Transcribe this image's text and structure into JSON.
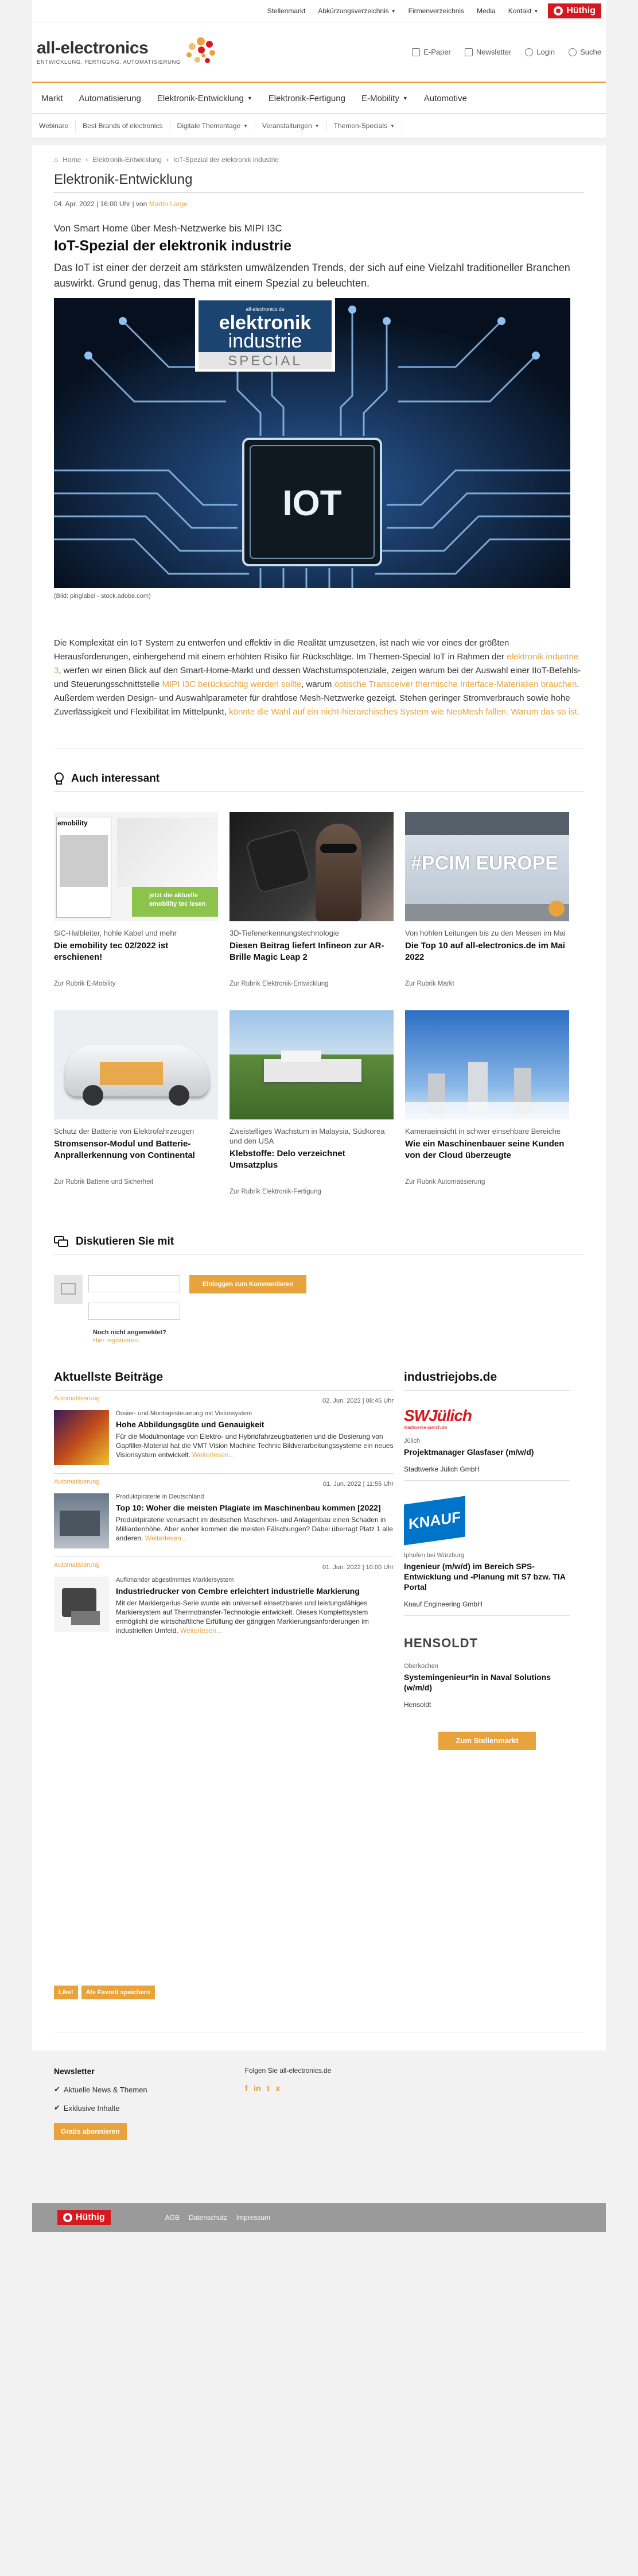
{
  "topbar": {
    "links": [
      "Stellenmarkt",
      "Abkürzungsverzeichnis",
      "Firmenverzeichnis",
      "Media",
      "Kontakt"
    ],
    "brand": "Hüthig"
  },
  "header": {
    "logo_name": "all-electronics",
    "logo_tag": "ENTWICKLUNG. FERTIGUNG. AUTOMATISIERUNG",
    "actions": [
      "E-Paper",
      "Newsletter",
      "Login",
      "Suche"
    ]
  },
  "mainnav": [
    "Markt",
    "Automatisierung",
    "Elektronik-Entwicklung",
    "Elektronik-Fertigung",
    "E-Mobility",
    "Automotive"
  ],
  "subnav": [
    "Webinare",
    "Best Brands of electronics",
    "Digitale Thementage",
    "Veranstaltungen",
    "Themen-Specials"
  ],
  "breadcrumb": {
    "home": "Home",
    "level1": "Elektronik-Entwicklung",
    "current": "IoT-Spezial der elektronik industrie"
  },
  "article": {
    "category": "Elektronik-Entwicklung",
    "meta_date": "04. Apr. 2022 | 16:00 Uhr | von",
    "meta_author": "Martin Large",
    "kicker": "Von Smart Home über Mesh-Netzwerke bis MIPI I3C",
    "title": "IoT-Spezial der elektronik industrie",
    "teaser": "Das IoT ist einer der derzeit am stärksten umwälzenden Trends, der sich auf eine Vielzahl traditioneller Branchen auswirkt. Grund genug, das Thema mit einem Spezial zu beleuchten.",
    "hero_brand_top": "all-electronics.de",
    "hero_brand_1": "elektronik",
    "hero_brand_2": "industrie",
    "hero_brand_3": "SPECIAL",
    "hero_chip": "IOT",
    "caption": "(Bild: pinglabel - stock.adobe.com)",
    "body_1": "Die Komplexität ein IoT System zu entwerfen und effektiv in die Realität umzusetzen, ist nach wie vor eines der größten Herausforderungen, einhergehend mit einem erhöhten Risiko für Rückschläge. Im Themen-Special IoT in Rahmen der ",
    "body_link1": "elektronik industrie 3",
    "body_2": ", werfen wir einen Blick auf den Smart-Home-Markt und dessen Wachstumspotenziale, zeigen warum bei der Auswahl einer IIoT-Befehls- und Steuerungsschnittstelle ",
    "body_link2": "MIPI I3C berücksichtig werden sollte",
    "body_3": ", warum ",
    "body_link3": "optische Transceiver thermische Interface-Materialien brauchen",
    "body_4": ". Außerdem werden Design- und Auswahlparameter für drahtlose Mesh-Netzwerke gezeigt. Stehen geringer Stromverbrauch sowie hohe Zuverlässigkeit und Flexibilität im Mittelpunkt, ",
    "body_link4": "könnte die Wahl auf ein nicht-hierarchisches System wie NeoMesh fallen. Warum das so ist."
  },
  "interesting": {
    "heading": "Auch interessant",
    "cards": [
      {
        "kicker": "SiC-Halbleiter, hohle Kabel und mehr",
        "title": "Die emobility tec 02/2022 ist erschienen!",
        "rubric": "Zur Rubrik E-Mobility",
        "thumb_label1": "emobility",
        "thumb_label2": "jetzt die aktuelle emobility tec lesen"
      },
      {
        "kicker": "3D-Tiefenerkennungstechnologie",
        "title": "Diesen Beitrag liefert Infineon zur AR-Brille Magic Leap 2",
        "rubric": "Zur Rubrik Elektronik-Entwicklung"
      },
      {
        "kicker": "Von hohlen Leitungen bis zu den Messen im Mai",
        "title": "Die Top 10 auf all-electronics.de im Mai 2022",
        "rubric": "Zur Rubrik Markt",
        "thumb_label1": "#PCIM EUROPE"
      },
      {
        "kicker": "Schutz der Batterie von Elektrofahrzeugen",
        "title": "Stromsensor-Modul und Batterie-Anprallerkennung von Continental",
        "rubric": "Zur Rubrik Batterie und Sicherheit"
      },
      {
        "kicker": "Zweistelliges Wachstum in Malaysia, Südkorea und den USA",
        "title": "Klebstoffe: Delo verzeichnet Umsatzplus",
        "rubric": "Zur Rubrik Elektronik-Fertigung"
      },
      {
        "kicker": "Kameraeinsicht in schwer einsehbare Bereiche",
        "title": "Wie ein Maschinenbauer seine Kunden von der Cloud überzeugte",
        "rubric": "Zur Rubrik Automatisierung"
      }
    ]
  },
  "discuss": {
    "heading": "Diskutieren Sie mit",
    "button": "Einloggen zum Kommentieren",
    "not_registered": "Noch nicht angemeldet?",
    "register": "Hier registrieren."
  },
  "latest": {
    "heading": "Aktuellste Beiträge",
    "posts": [
      {
        "category": "Automatisierung",
        "date": "02. Jun. 2022 | 08:45 Uhr",
        "kicker": "Dosier- und Montagesteuerung mit Visionsystem",
        "title": "Hohe Abbildungsgüte und Genauigkeit",
        "desc": "Für die Modulmontage von Elektro- und Hybridfahrzeugbatterien und die Dosierung von Gapfiller-Material hat die VMT Vision Machine Technic Bildverarbeitungssysteme ein neues Visionsystem entwickelt.",
        "more": "Weiterlesen..."
      },
      {
        "category": "Automatisierung",
        "date": "01. Jun. 2022 | 11:55 Uhr",
        "kicker": "Produktpiraterie in Deutschland",
        "title": "Top 10: Woher die meisten Plagiate im Maschinenbau kommen [2022]",
        "desc": "Produktpiraterie verursacht im deutschen Maschinen- und Anlagenbau einen Schaden in Milliardenhöhe. Aber woher kommen die meisten Fälschungen? Dabei überragt Platz 1 alle anderen.",
        "more": "Weiterlesen..."
      },
      {
        "category": "Automatisierung",
        "date": "01. Jun. 2022 | 10:00 Uhr",
        "kicker": "Aufkmander abgestimmtes Markiersystem",
        "title": "Industriedrucker von Cembre erleichtert industrielle Markierung",
        "desc": "Mit der Markiergerius-Serie wurde ein universell einsetzbares und leistungsfähiges Markiersystem auf Thermotransfer-Technologie entwickelt. Dieses Komplettsystem ermöglicht die wirtschaftliche Erfüllung der gängigen Markierungsanforderungen im industriellen Umfeld.",
        "more": "Weiterlesen..."
      }
    ]
  },
  "jobs": {
    "heading": "industriejobs.de",
    "items": [
      {
        "logo": "SWJülich",
        "logo_sub": "stadtwerke-juelich.de",
        "location": "Jülich",
        "title": "Projektmanager Glasfaser (m/w/d)",
        "company": "Stadtwerke Jülich GmbH"
      },
      {
        "logo": "KNAUF",
        "location": "Iphofen bei Würzburg",
        "title": "Ingenieur (m/w/d) im Bereich SPS-Entwicklung und -Planung mit S7 bzw. TIA Portal",
        "company": "Knauf Engineering GmbH"
      },
      {
        "logo": "HENSOLDT",
        "location": "Oberkochen",
        "title": "Systemingenieur*in in Naval Solutions (w/m/d)",
        "company": "Hensoldt"
      }
    ],
    "button": "Zum Stellenmarkt"
  },
  "actions_row": [
    "Like!",
    "Als Favorit speichern"
  ],
  "footer": {
    "newsletter_h": "Newsletter",
    "items": [
      "Aktuelle News & Themen",
      "Exklusive Inhalte"
    ],
    "subscribe": "Gratis abonnieren",
    "follow": "Folgen Sie all-electronics.de"
  },
  "bottombar": {
    "brand": "Hüthig",
    "links": [
      "AGB",
      "Datenschutz",
      "Impressum"
    ]
  },
  "colors": {
    "accent": "#e8a33c",
    "brand_red": "#d6191f"
  }
}
